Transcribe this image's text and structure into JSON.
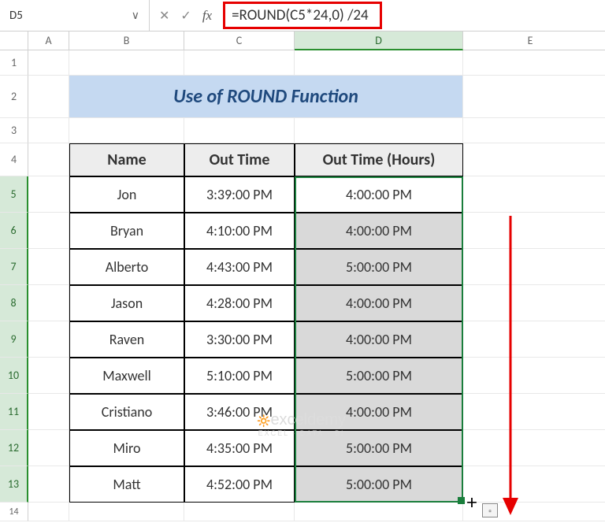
{
  "name_box": "D5",
  "formula": "=ROUND(C5*24,0) /24",
  "columns": [
    "A",
    "B",
    "C",
    "D",
    "E"
  ],
  "rows_visible": [
    "1",
    "2",
    "3",
    "4",
    "5",
    "6",
    "7",
    "8",
    "9",
    "10",
    "11",
    "12",
    "13"
  ],
  "title": "Use of ROUND Function",
  "headers": {
    "b": "Name",
    "c": "Out Time",
    "d": "Out Time (Hours)"
  },
  "db": [
    {
      "name": "Jon",
      "out": "3:39:00 PM",
      "round": "4:00:00 PM"
    },
    {
      "name": "Bryan",
      "out": "4:10:00 PM",
      "round": "4:00:00 PM"
    },
    {
      "name": "Alberto",
      "out": "4:43:00 PM",
      "round": "5:00:00 PM"
    },
    {
      "name": "Jason",
      "out": "4:28:00 PM",
      "round": "4:00:00 PM"
    },
    {
      "name": "Raven",
      "out": "3:30:00 PM",
      "round": "4:00:00 PM"
    },
    {
      "name": "Maxwell",
      "out": "5:10:00 PM",
      "round": "5:00:00 PM"
    },
    {
      "name": "Cristiano",
      "out": "3:46:00 PM",
      "round": "4:00:00 PM"
    },
    {
      "name": "Miro",
      "out": "4:35:00 PM",
      "round": "5:00:00 PM"
    },
    {
      "name": "Matt",
      "out": "4:52:00 PM",
      "round": "5:00:00 PM"
    }
  ],
  "watermark": {
    "main": "exceldemy",
    "sub": "EXCEL · DATA · BI"
  },
  "icons": {
    "chevron": "∨",
    "cancel": "✕",
    "check": "✓",
    "fx": "fx"
  }
}
